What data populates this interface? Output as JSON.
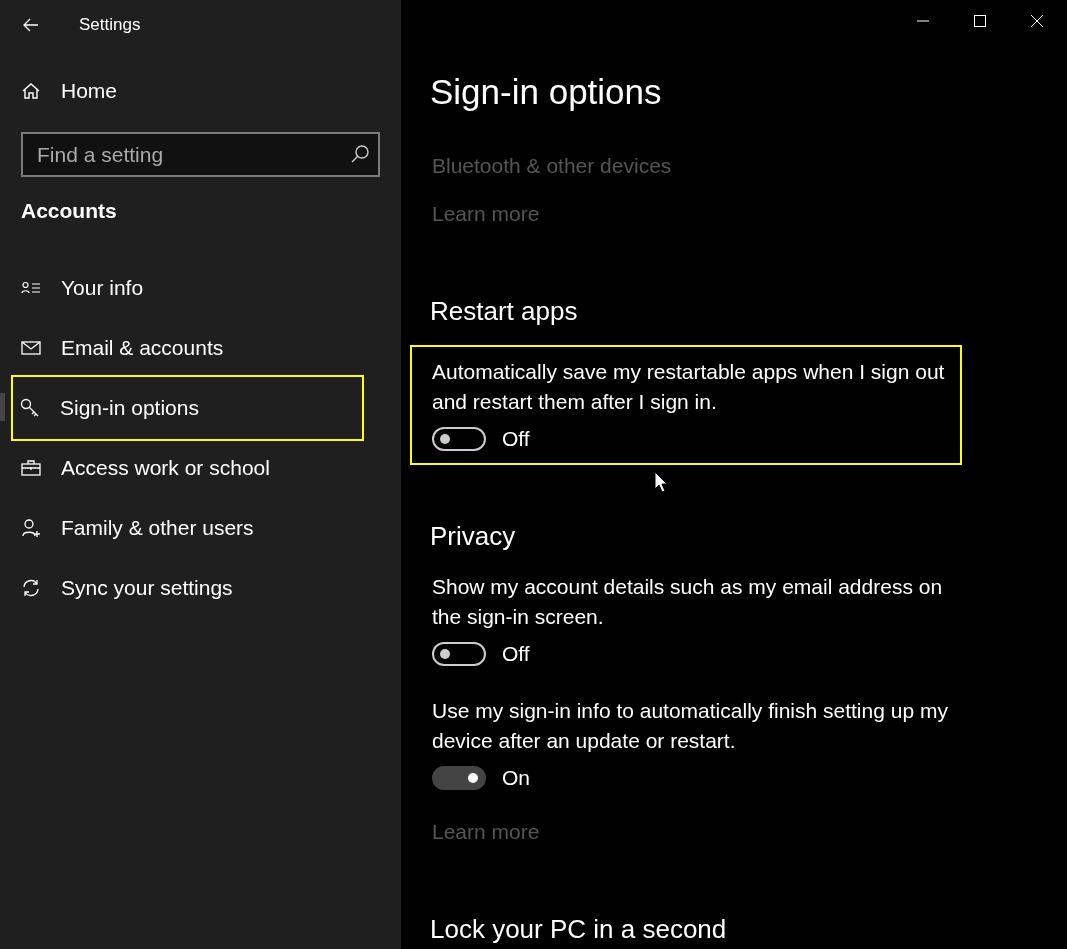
{
  "window": {
    "title": "Settings"
  },
  "sidebar": {
    "home": {
      "label": "Home"
    },
    "search": {
      "placeholder": "Find a setting"
    },
    "section_title": "Accounts",
    "items": [
      {
        "label": "Your info",
        "kind": "person-list",
        "selected": false,
        "highlighted": false
      },
      {
        "label": "Email & accounts",
        "kind": "mail",
        "selected": false,
        "highlighted": false
      },
      {
        "label": "Sign-in options",
        "kind": "key",
        "selected": true,
        "highlighted": true
      },
      {
        "label": "Access work or school",
        "kind": "briefcase",
        "selected": false,
        "highlighted": false
      },
      {
        "label": "Family & other users",
        "kind": "person-add",
        "selected": false,
        "highlighted": false
      },
      {
        "label": "Sync your settings",
        "kind": "sync",
        "selected": false,
        "highlighted": false
      }
    ]
  },
  "main": {
    "title": "Sign-in options",
    "blocks": [
      {
        "kind": "link",
        "text": "Bluetooth & other devices"
      },
      {
        "kind": "link",
        "text": "Learn more"
      },
      {
        "kind": "heading",
        "text": "Restart apps"
      },
      {
        "kind": "toggle",
        "description": "Automatically save my restartable apps when I sign out and restart them after I sign in.",
        "on": false,
        "state_label": "Off",
        "highlighted": true
      },
      {
        "kind": "heading",
        "text": "Privacy"
      },
      {
        "kind": "toggle",
        "description": "Show my account details such as my email address on the sign-in screen.",
        "on": false,
        "state_label": "Off",
        "highlighted": false
      },
      {
        "kind": "toggle",
        "description": "Use my sign-in info to automatically finish setting up my device after an update or restart.",
        "on": true,
        "state_label": "On",
        "highlighted": false
      },
      {
        "kind": "link",
        "text": "Learn more"
      },
      {
        "kind": "heading",
        "text": "Lock your PC in a second"
      }
    ]
  }
}
